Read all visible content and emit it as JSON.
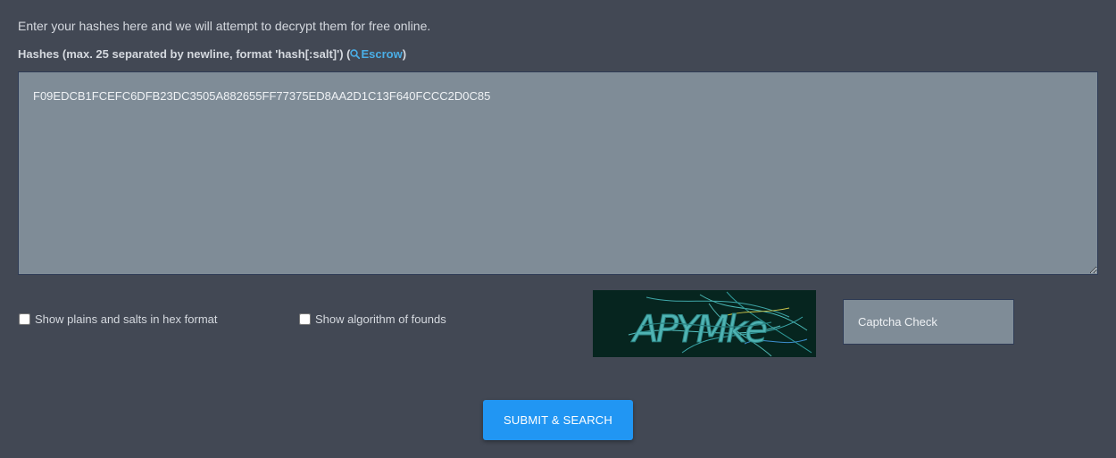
{
  "intro_text": "Enter your hashes here and we will attempt to decrypt them for free online.",
  "hash_label": {
    "prefix": "Hashes (max. 25 separated by newline, format 'hash[:salt]') (",
    "link_text": "Escrow",
    "suffix": ")",
    "link_icon": "search-icon"
  },
  "hash_input": {
    "value": "F09EDCB1FCEFC6DFB23DC3505A882655FF77375ED8AA2D1C13F640FCCC2D0C85"
  },
  "options": {
    "hex_format": {
      "label": "Show plains and salts in hex format",
      "checked": false
    },
    "show_algorithm": {
      "label": "Show algorithm of founds",
      "checked": false
    }
  },
  "captcha": {
    "image_text": "APYMke",
    "input_placeholder": "Captcha Check",
    "input_value": ""
  },
  "submit_label": "SUBMIT & SEARCH",
  "colors": {
    "background": "#424854",
    "field_background": "#7f8c97",
    "link": "#4aaee6",
    "button": "#2196f3"
  }
}
